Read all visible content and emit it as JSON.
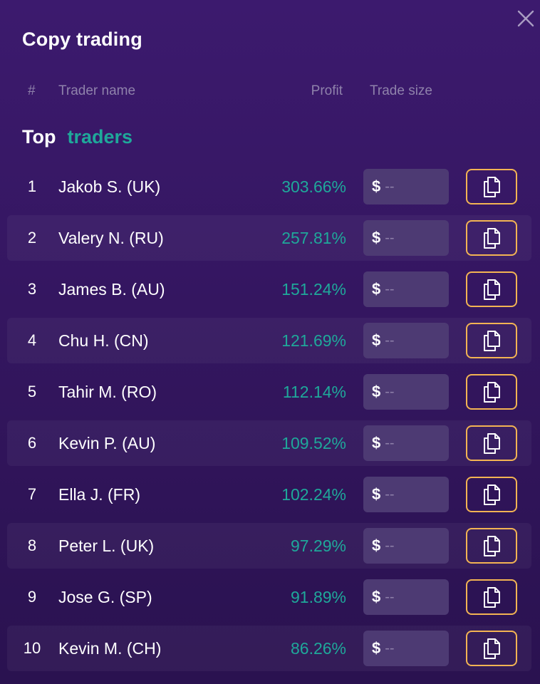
{
  "dialog": {
    "title": "Copy trading",
    "close_icon": "close-icon"
  },
  "table": {
    "headers": {
      "rank": "#",
      "name": "Trader name",
      "profit": "Profit",
      "trade_size": "Trade size"
    },
    "section": {
      "word1": "Top",
      "word2": "traders"
    },
    "trade_size_currency": "$",
    "trade_size_placeholder": "--",
    "copy_icon": "copy-icon",
    "rows": [
      {
        "rank": "1",
        "name": "Jakob S. (UK)",
        "profit": "303.66%"
      },
      {
        "rank": "2",
        "name": "Valery N. (RU)",
        "profit": "257.81%"
      },
      {
        "rank": "3",
        "name": "James B. (AU)",
        "profit": "151.24%"
      },
      {
        "rank": "4",
        "name": "Chu H. (CN)",
        "profit": "121.69%"
      },
      {
        "rank": "5",
        "name": "Tahir M. (RO)",
        "profit": "112.14%"
      },
      {
        "rank": "6",
        "name": "Kevin P. (AU)",
        "profit": "109.52%"
      },
      {
        "rank": "7",
        "name": "Ella J. (FR)",
        "profit": "102.24%"
      },
      {
        "rank": "8",
        "name": "Peter L. (UK)",
        "profit": "97.29%"
      },
      {
        "rank": "9",
        "name": "Jose G. (SP)",
        "profit": "91.89%"
      },
      {
        "rank": "10",
        "name": "Kevin M. (CH)",
        "profit": "86.26%"
      }
    ]
  },
  "colors": {
    "accent_profit": "#1fa89a",
    "copy_border": "#f3b453",
    "background": "#3c1a6e"
  }
}
